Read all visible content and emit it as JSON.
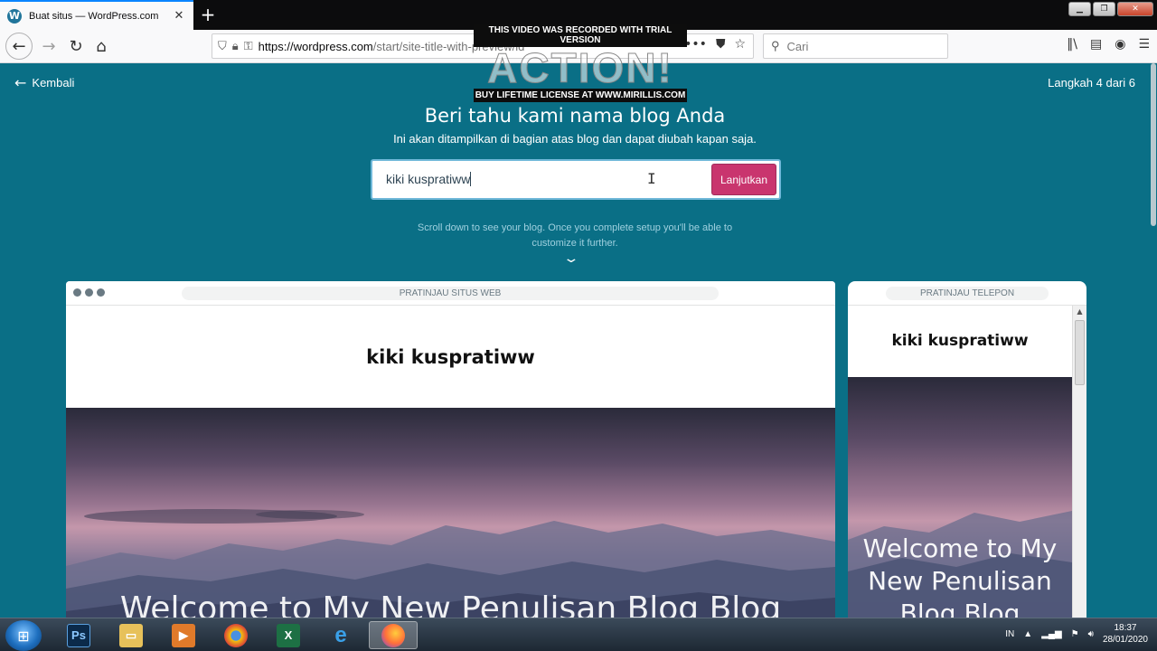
{
  "browser": {
    "tab_title": "Buat situs — WordPress.com",
    "tab_favicon": "wordpress-icon",
    "url_host": "https://wordpress.com",
    "url_path": "/start/site-title-with-preview/id",
    "search_placeholder": "Cari"
  },
  "watermark": {
    "top_text": "THIS VIDEO WAS RECORDED WITH TRIAL VERSION",
    "logo_text": "ACTION!",
    "bottom_text": "BUY LIFETIME LICENSE AT WWW.MIRILLIS.COM"
  },
  "page": {
    "back_label": "Kembali",
    "step_label": "Langkah 4 dari 6",
    "heading": "Beri tahu kami nama blog Anda",
    "subheading": "Ini akan ditampilkan di bagian atas blog dan dapat diubah kapan saja.",
    "site_title_value": "kiki kuspratiww",
    "continue_button": "Lanjutkan",
    "hint": "Scroll down to see your blog. Once you complete setup you'll be able to customize it further.",
    "accent_color": "#c9356e",
    "background_color": "#0a6f86"
  },
  "web_preview": {
    "label": "PRATINJAU SITUS WEB",
    "site_title": "kiki kuspratiww",
    "hero_text": "Welcome to My New Penulisan Blog Blog"
  },
  "phone_preview": {
    "label": "PRATINJAU TELEPON",
    "site_title": "kiki kuspratiww",
    "hero_text": "Welcome to My New Penulisan Blog Blog"
  },
  "taskbar": {
    "apps": [
      "photoshop-icon",
      "file-explorer-icon",
      "media-player-icon",
      "chrome-icon",
      "excel-icon",
      "internet-explorer-icon",
      "firefox-icon"
    ],
    "language": "IN",
    "time": "18:37",
    "date": "28/01/2020"
  }
}
